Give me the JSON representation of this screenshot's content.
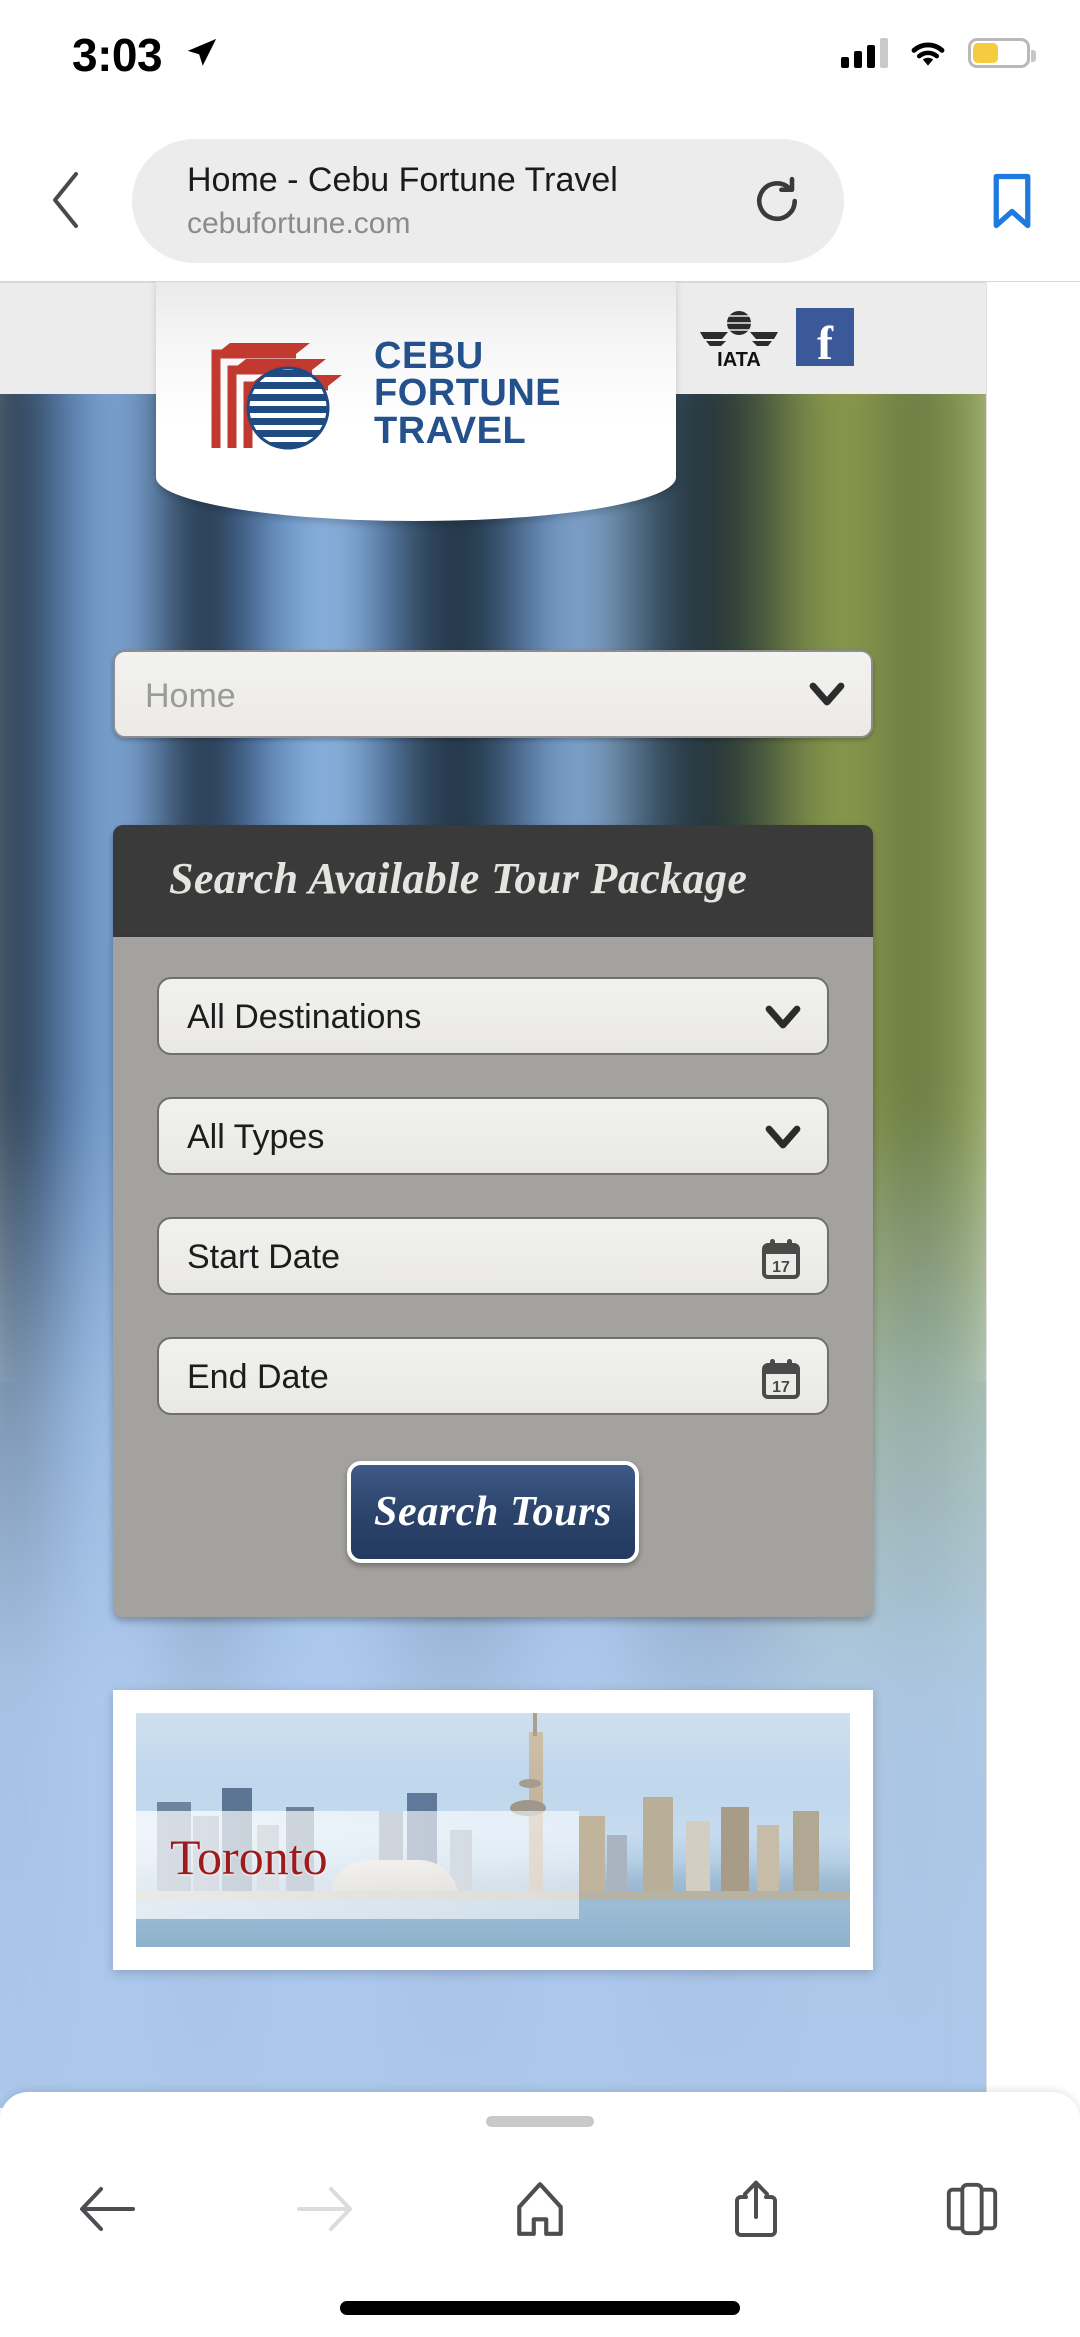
{
  "status_bar": {
    "time": "3:03",
    "location_icon": "location-arrow-icon",
    "signal_icon": "cellular-signal-icon",
    "signal_bars_filled": 3,
    "signal_bars_total": 4,
    "wifi_icon": "wifi-icon",
    "battery_icon": "battery-icon",
    "battery_level_percent": 44,
    "battery_color": "#f5cb3f"
  },
  "browser": {
    "back_icon": "chevron-left-icon",
    "address_bar": {
      "page_title": "Home - Cebu Fortune Travel",
      "host": "cebufortune.com",
      "reload_icon": "reload-icon"
    },
    "bookmark_icon": "bookmark-icon",
    "bookmark_color": "#1f7ae0",
    "toolbar": [
      {
        "name": "back",
        "icon": "arrow-left-icon",
        "enabled": true
      },
      {
        "name": "forward",
        "icon": "arrow-right-icon",
        "enabled": false
      },
      {
        "name": "home",
        "icon": "home-icon",
        "enabled": true
      },
      {
        "name": "share",
        "icon": "share-icon",
        "enabled": true
      },
      {
        "name": "tabs",
        "icon": "tabs-icon",
        "enabled": true
      }
    ]
  },
  "site": {
    "header": {
      "logo": {
        "line1": "CEBU",
        "line2": "FORTUNE",
        "line3": "TRAVEL",
        "mark_icon": "cebu-fortune-globe-logo",
        "text_color": "#24518c",
        "accent_color": "#c1392f"
      },
      "badges": [
        {
          "name": "iata",
          "label": "IATA",
          "icon": "iata-winged-globe-icon"
        },
        {
          "name": "facebook",
          "label": "f",
          "icon": "facebook-icon",
          "color": "#3b5998"
        }
      ]
    },
    "nav_select": {
      "value": "Home",
      "chevron_icon": "chevron-down-icon"
    },
    "search_panel": {
      "title": "Search Available Tour Package",
      "header_color": "#3a3a3a",
      "body_color": "#a3a29e",
      "fields": [
        {
          "name": "destination",
          "value": "All Destinations",
          "trailing_icon": "chevron-down-icon"
        },
        {
          "name": "type",
          "value": "All Types",
          "trailing_icon": "chevron-down-icon"
        },
        {
          "name": "start-date",
          "value": "Start Date",
          "trailing_icon": "calendar-icon"
        },
        {
          "name": "end-date",
          "value": "End Date",
          "trailing_icon": "calendar-icon"
        }
      ],
      "submit": {
        "label": "Search Tours",
        "color": "#2b426a"
      }
    },
    "destination_card": {
      "label": "Toronto",
      "label_color": "#9e1b1b",
      "image_alt": "toronto-skyline-cn-tower"
    }
  }
}
